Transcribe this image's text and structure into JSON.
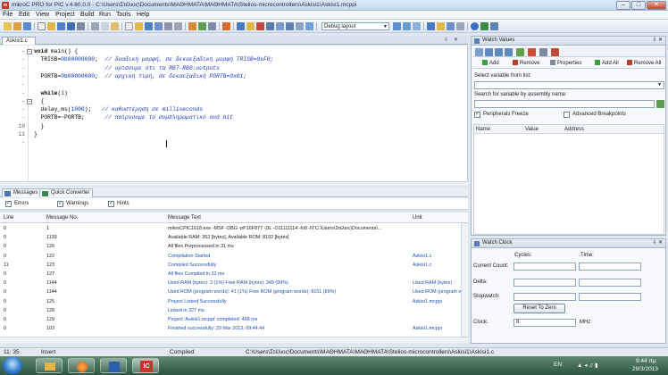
{
  "window": {
    "title": "mikroC PRO for PIC v.4.60.0.0 - C:\\Users\\Στέλιος\\Documents\\ΜΑΘΗΜΑΤΑ\\ΜΑΘΗΜΑΤΑ\\Stelios-microcontrollers\\Askisi1\\Askisi1.mcppi"
  },
  "menu": [
    "File",
    "Edit",
    "View",
    "Project",
    "Build",
    "Run",
    "Tools",
    "Help"
  ],
  "toolbar": {
    "layout_combo": "Debug layout"
  },
  "editor": {
    "tab_label": "Askisi1.c",
    "lines": [
      {
        "num": "-",
        "text": "void main() {"
      },
      {
        "num": "-",
        "text": "  TRISB=0b00000000;  // δυαδική μορφή, σε δεκαεξαδική μορφή TRISB=0xF0;"
      },
      {
        "num": "-",
        "text": "                     // ορίσουμε ότι τα RB7-RB0:outputs"
      },
      {
        "num": "-",
        "text": "  PORTB=0b00000000;  // αρχική τιμή, σε δεκαεξαδική PORTB=0x01;"
      },
      {
        "num": "-",
        "text": ""
      },
      {
        "num": "-",
        "text": "  while(1)"
      },
      {
        "num": "-",
        "text": "  {"
      },
      {
        "num": "-",
        "text": "  delay_ms(1000);   // καθυστέρηση σε milliseconds"
      },
      {
        "num": "-",
        "text": "  PORTB=~PORTB;      // παίρνουμε το συμπληρωματικό ανά bit"
      },
      {
        "num": "10",
        "text": "  }"
      },
      {
        "num": "11",
        "text": "}"
      },
      {
        "num": "-",
        "text": ""
      }
    ]
  },
  "messages": {
    "tabs": [
      "Messages",
      "Quick Converter"
    ],
    "filters": [
      "Errors",
      "Warnings",
      "Hints"
    ],
    "columns": [
      "Line",
      "Message No.",
      "Message Text",
      "Unit"
    ],
    "rows": [
      [
        "0",
        "1",
        "mikroCPIC1618.exe -MSF -DBG -pP16F877 -DL -O11111114 -fo8 -N\"C:\\Users\\Στέλιος\\Documents\\...",
        ""
      ],
      [
        "0",
        "1139",
        "Available RAM: 352 [bytes], Available ROM: 8192 [bytes]",
        ""
      ],
      [
        "0",
        "126",
        "All files Preprocessed in 31 ms",
        ""
      ],
      [
        "0",
        "122",
        "Compilation Started",
        "Askisi1.c"
      ],
      [
        "11",
        "123",
        "Compiled Successfully",
        "Askisi1.c"
      ],
      [
        "0",
        "127",
        "All files Compiled in 32 ms",
        ""
      ],
      [
        "0",
        "1144",
        "Used RAM (bytes): 3 (1%)  Free RAM (bytes): 349 (99%)",
        "Used RAM (bytes)"
      ],
      [
        "0",
        "1144",
        "Used ROM (program words): 41 (1%)  Free ROM (program words): 8151 (99%)",
        "Used ROM (program wo"
      ],
      [
        "0",
        "125",
        "Project Linked Successfully",
        "Askisi1.mcppi"
      ],
      [
        "0",
        "128",
        "Linked in 327 ms",
        ""
      ],
      [
        "0",
        "129",
        "Project 'Askisi1.mcppi' completed: 468 ms",
        ""
      ],
      [
        "0",
        "103",
        "Finished successfully: 29 Mar 2013, 09:44:44",
        "Askisi1.mcppi"
      ]
    ]
  },
  "watch_values": {
    "title": "Watch Values",
    "buttons": [
      "Add",
      "Remove",
      "Properties",
      "Add All",
      "Remove All"
    ],
    "select_label": "Select variable from list:",
    "search_label": "Search for variable by assembly name:",
    "peripherals_freeze": "Peripherals Freeze",
    "advanced_breakpoints": "Advanced Breakpoints",
    "columns": [
      "Name",
      "Value",
      "Address"
    ]
  },
  "watch_clock": {
    "title": "Watch Clock",
    "col_cycles": "Cycles:",
    "col_time": "Time:",
    "current_count": "Current Count:",
    "delta": "Delta:",
    "stopwatch": "Stopwatch:",
    "reset_button": "Reset To Zero",
    "clock_label": "Clock:",
    "clock_value": "8",
    "clock_unit": "MHz"
  },
  "status": {
    "position": "11: 35",
    "mode": "Insert",
    "state": "Compiled",
    "path": "C:\\Users\\Στέλιος\\Documents\\ΜΑΘΗΜΑΤΑ\\ΜΑΘΗΜΑΤΑ\\Stelios-microcontrollers\\Askisi1\\Askisi1.c"
  },
  "taskbar": {
    "lang": "EN",
    "time": "9:44 πμ",
    "date": "29/3/2013"
  }
}
